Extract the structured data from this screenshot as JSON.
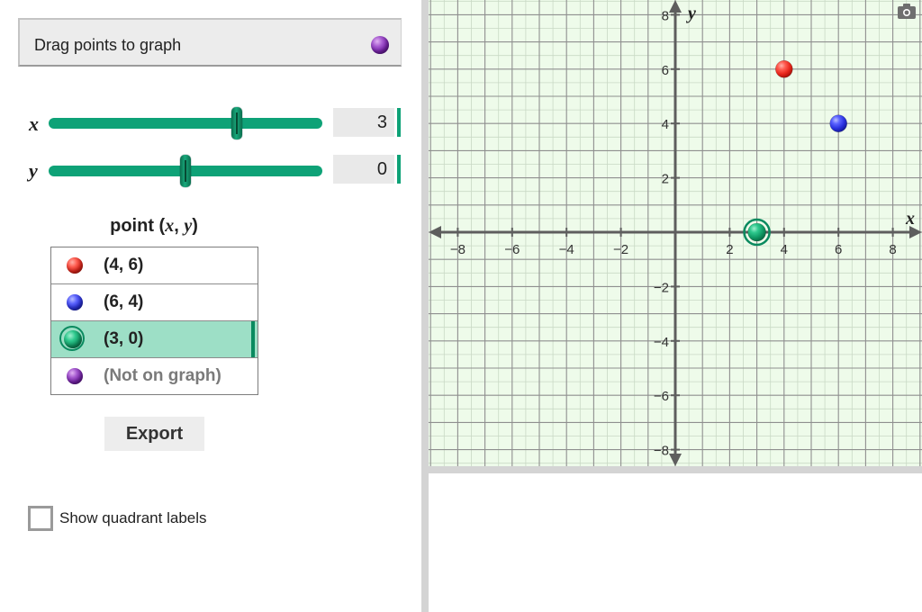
{
  "tool": {
    "label": "Drag points to graph",
    "ball_color": "purple"
  },
  "sliders": [
    {
      "name": "x",
      "value": "3",
      "range": [
        -8,
        8
      ]
    },
    {
      "name": "y",
      "value": "0",
      "range": [
        -8,
        8
      ]
    }
  ],
  "table": {
    "title_prefix": "point (",
    "title_x": "x",
    "title_sep": ", ",
    "title_y": "y",
    "title_suffix": ")",
    "rows": [
      {
        "label": "(4, 6)",
        "color": "red",
        "selected": false
      },
      {
        "label": "(6, 4)",
        "color": "blue",
        "selected": false
      },
      {
        "label": "(3, 0)",
        "color": "green",
        "selected": true
      },
      {
        "label": "(Not on graph)",
        "color": "purple",
        "selected": false
      }
    ]
  },
  "export_label": "Export",
  "quadrant_checkbox": {
    "label": "Show quadrant labels",
    "checked": false
  },
  "graph": {
    "x_axis_label": "x",
    "y_axis_label": "y",
    "x_ticks": [
      "−8",
      "−6",
      "−4",
      "−2",
      "2",
      "4",
      "6",
      "8"
    ],
    "y_ticks": [
      "8",
      "6",
      "4",
      "2",
      "−2",
      "−4",
      "−6",
      "−8"
    ],
    "points": [
      {
        "x": 4,
        "y": 6,
        "color": "red"
      },
      {
        "x": 6,
        "y": 4,
        "color": "blue"
      },
      {
        "x": 3,
        "y": 0,
        "color": "green",
        "selected": true
      }
    ]
  },
  "colors": {
    "accent": "#0ea277",
    "grid_background": "#eefbea",
    "major_grid": "#8f8f8f",
    "minor_grid": "#c9d9c5",
    "selected_row": "#9ddfc6"
  }
}
